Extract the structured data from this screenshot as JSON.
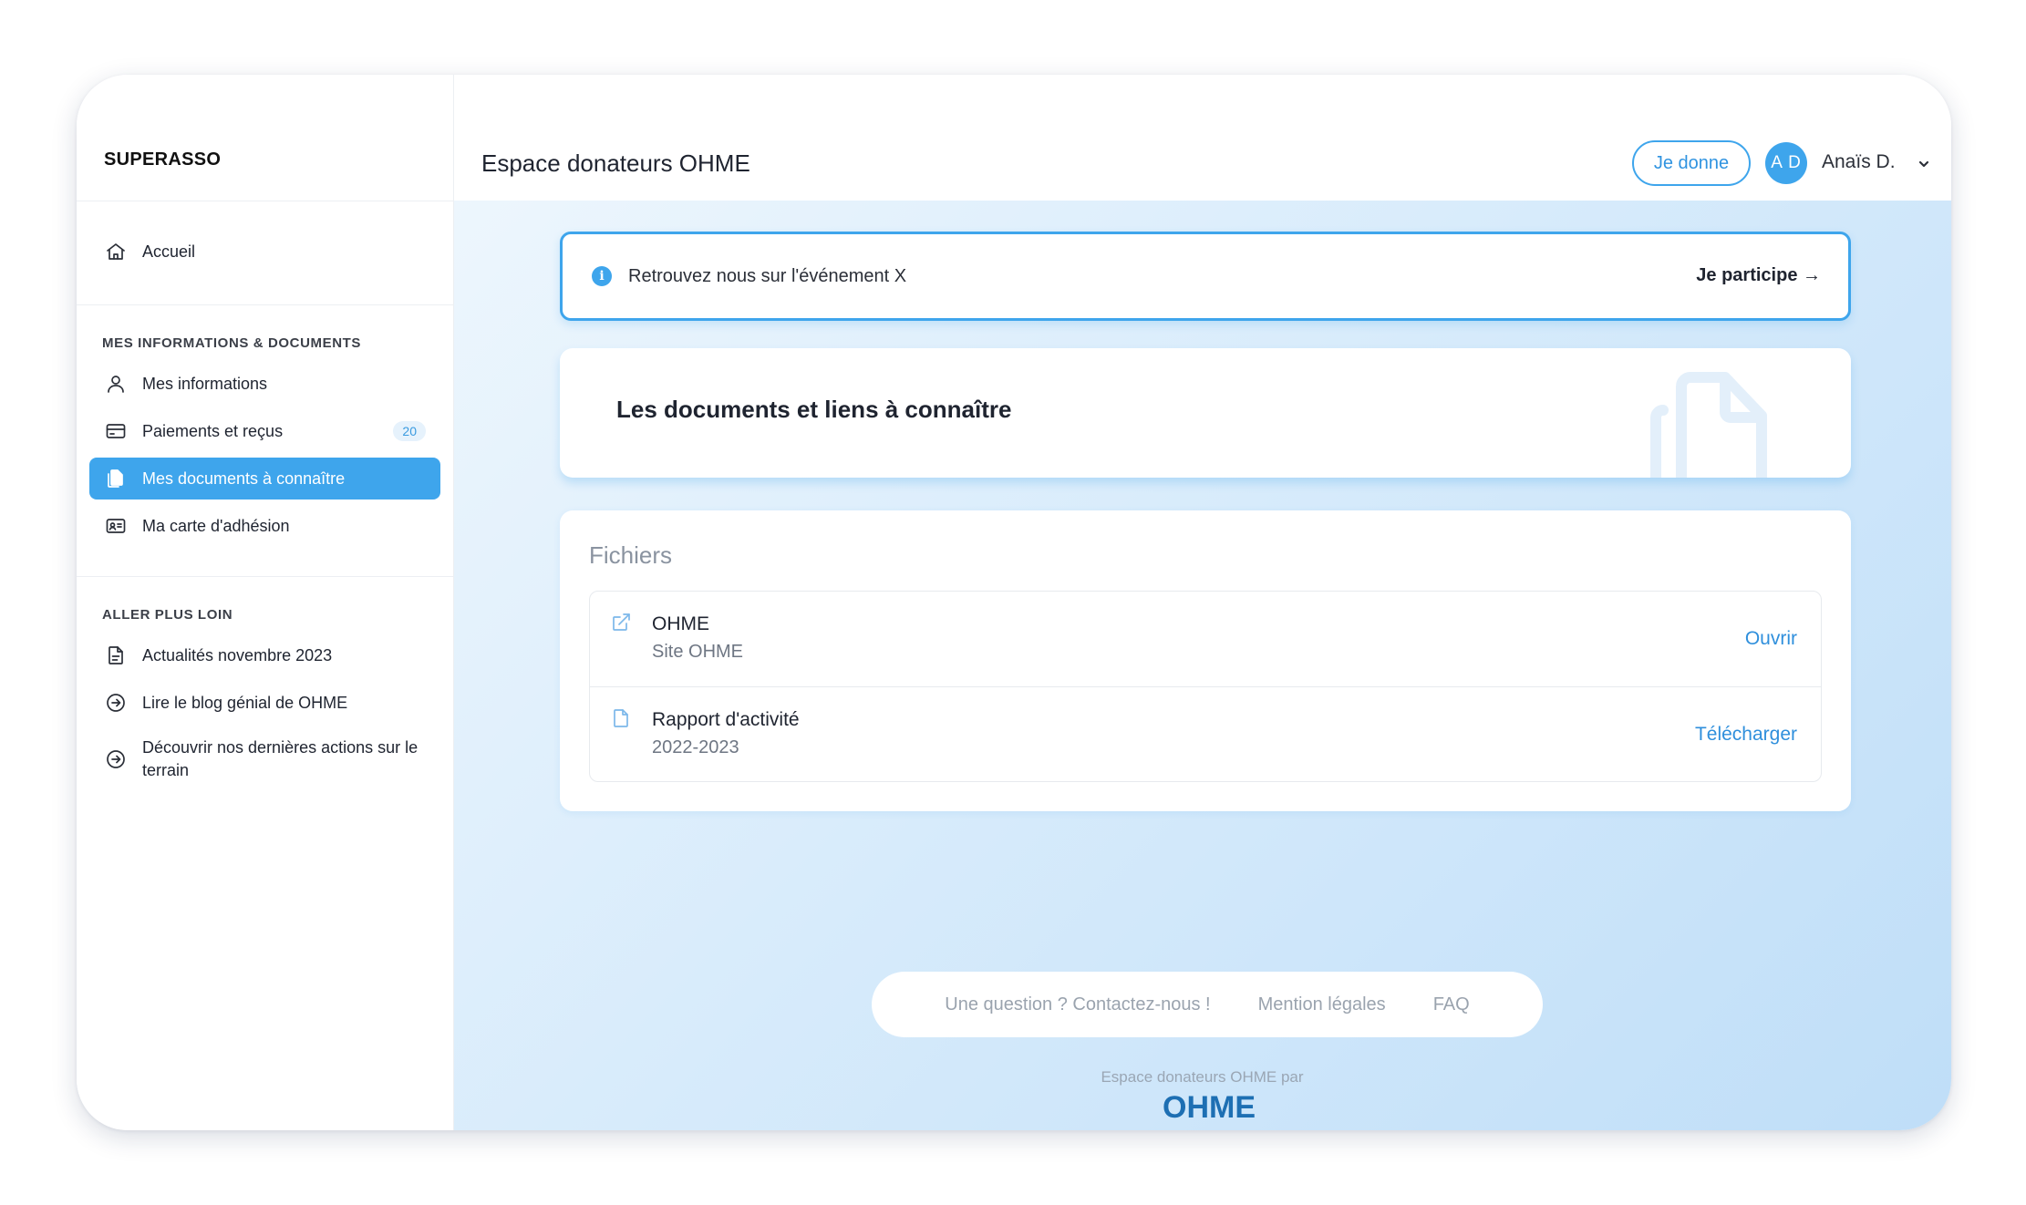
{
  "brand": "SUPERASSO",
  "header": {
    "title": "Espace donateurs OHME",
    "donate_label": "Je donne",
    "avatar_initials": "A D",
    "user_name": "Anaïs D."
  },
  "sidebar": {
    "home": {
      "label": "Accueil",
      "icon": "home-icon"
    },
    "section1": "MES INFORMATIONS & DOCUMENTS",
    "items1": [
      {
        "label": "Mes informations",
        "icon": "user-icon"
      },
      {
        "label": "Paiements et reçus",
        "icon": "credit-card-icon",
        "badge": "20"
      },
      {
        "label": "Mes documents à connaître",
        "icon": "documents-icon",
        "active": true
      },
      {
        "label": "Ma carte d'adhésion",
        "icon": "id-card-icon"
      }
    ],
    "section2": "ALLER PLUS LOIN",
    "items2": [
      {
        "label": "Actualités novembre 2023",
        "icon": "file-text-icon"
      },
      {
        "label": "Lire le blog génial de OHME",
        "icon": "arrow-circle-icon"
      },
      {
        "label": "Découvrir nos dernières actions sur le terrain",
        "icon": "arrow-circle-icon"
      }
    ]
  },
  "banner": {
    "text": "Retrouvez nous sur l'événement X",
    "cta": "Je participe →"
  },
  "hero": {
    "title": "Les documents et liens à connaître"
  },
  "files": {
    "title": "Fichiers",
    "rows": [
      {
        "name": "OHME",
        "sub": "Site OHME",
        "action": "Ouvrir",
        "icon": "external-link-icon"
      },
      {
        "name": "Rapport d'activité",
        "sub": "2022-2023",
        "action": "Télécharger",
        "icon": "file-icon"
      }
    ]
  },
  "footer": {
    "links": [
      "Une question ? Contactez-nous !",
      "Mention légales",
      "FAQ"
    ],
    "powered_by": "Espace donateurs OHME par",
    "logo_text": "OHME"
  },
  "colors": {
    "accent": "#3ea5ec",
    "link": "#2f8fdc"
  }
}
